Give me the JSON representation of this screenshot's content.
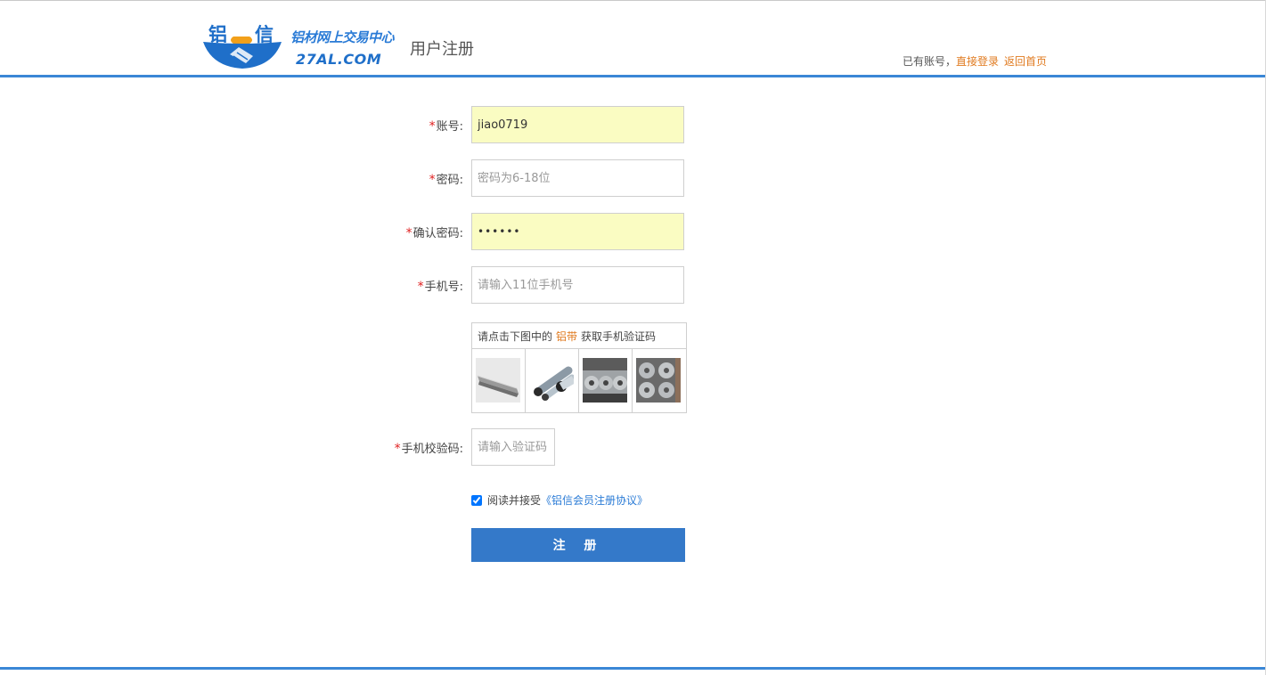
{
  "header": {
    "logo": {
      "char_left": "铝",
      "char_right": "信",
      "tagline": "铝材网上交易中心",
      "domain": "27AL.COM"
    },
    "page_title": "用户注册",
    "have_account_text": "已有账号，",
    "login_link": "直接登录",
    "home_link": "返回首页"
  },
  "form": {
    "required_mark": "*",
    "account": {
      "label": "账号:",
      "value": "jiao0719"
    },
    "password": {
      "label": "密码:",
      "placeholder": "密码为6-18位"
    },
    "confirm_password": {
      "label": "确认密码:",
      "value": "••••••"
    },
    "phone": {
      "label": "手机号:",
      "placeholder": "请输入11位手机号"
    },
    "captcha": {
      "tip_prefix": "请点击下图中的",
      "keyword": "铝带",
      "tip_suffix": "获取手机验证码",
      "images": [
        "aluminum-profile",
        "aluminum-tubes",
        "aluminum-coils",
        "aluminum-strip-rolls"
      ]
    },
    "sms_code": {
      "label": "手机校验码:",
      "placeholder": "请输入验证码"
    },
    "agreement": {
      "checked": true,
      "text": "阅读并接受",
      "link": "《铝信会员注册协议》"
    },
    "submit_label": "注 册"
  },
  "colors": {
    "brand_blue": "#3a87d6",
    "button_blue": "#3479c9",
    "link_orange": "#e07a1f",
    "autofill_yellow": "#fafcc2",
    "required_red": "#e02020"
  }
}
